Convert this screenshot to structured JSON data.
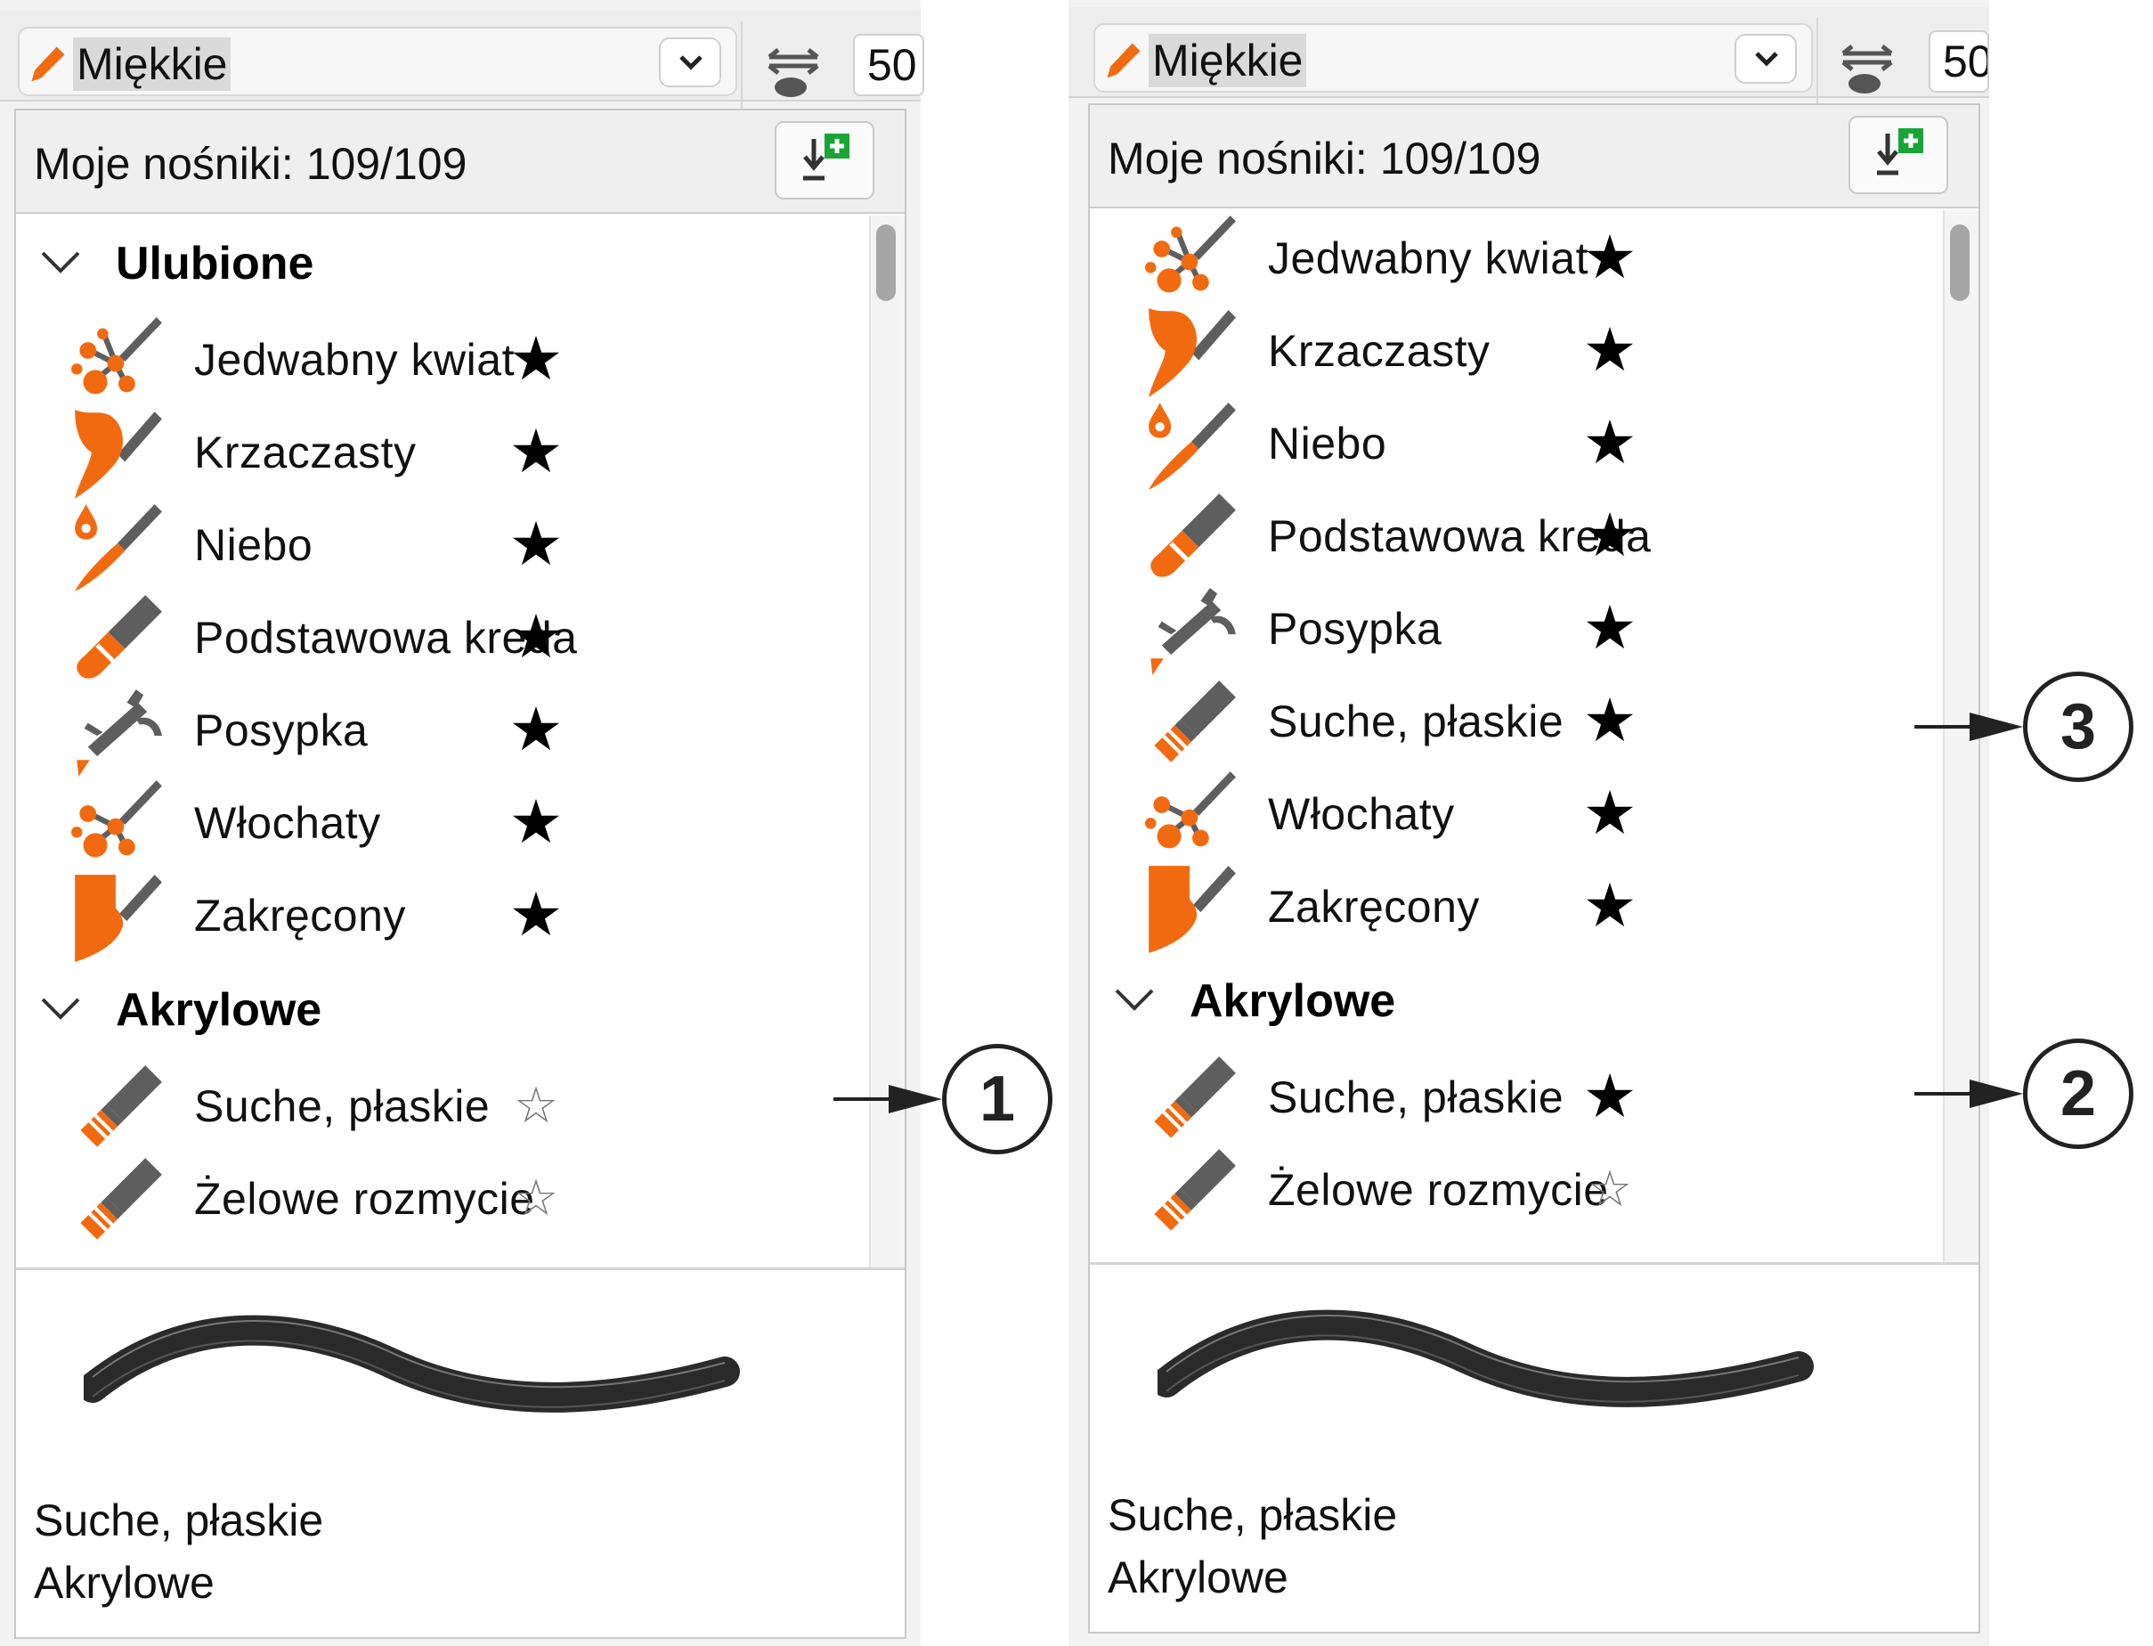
{
  "left_panel": {
    "preset_name": "Miękkie",
    "size_value": "50",
    "media_count": "Moje nośniki: 109/109",
    "categories": [
      {
        "label": "Ulubione",
        "items": [
          {
            "label": "Jedwabny kwiat",
            "icon": "silk-flower-brush-icon",
            "fav": true
          },
          {
            "label": "Krzaczasty",
            "icon": "bushy-brush-icon",
            "fav": true
          },
          {
            "label": "Niebo",
            "icon": "sky-brush-icon",
            "fav": true
          },
          {
            "label": "Podstawowa kreda",
            "icon": "basic-chalk-icon",
            "fav": true
          },
          {
            "label": "Posypka",
            "icon": "sprinkle-airbrush-icon",
            "fav": true
          },
          {
            "label": "Włochaty",
            "icon": "hairy-brush-icon",
            "fav": true
          },
          {
            "label": "Zakręcony",
            "icon": "curly-brush-icon",
            "fav": true
          }
        ]
      },
      {
        "label": "Akrylowe",
        "items": [
          {
            "label": "Suche, płaskie",
            "icon": "dry-flat-brush-icon",
            "fav": false
          },
          {
            "label": "Żelowe rozmycie",
            "icon": "gel-blend-brush-icon",
            "fav": false
          }
        ]
      }
    ],
    "preview": {
      "name": "Suche, płaskie",
      "category": "Akrylowe"
    },
    "callout": "1"
  },
  "right_panel": {
    "preset_name": "Miękkie",
    "size_value": "50",
    "media_count": "Moje nośniki: 109/109",
    "favorites": [
      {
        "label": "Jedwabny kwiat",
        "icon": "silk-flower-brush-icon",
        "fav": true
      },
      {
        "label": "Krzaczasty",
        "icon": "bushy-brush-icon",
        "fav": true
      },
      {
        "label": "Niebo",
        "icon": "sky-brush-icon",
        "fav": true
      },
      {
        "label": "Podstawowa kreda",
        "icon": "basic-chalk-icon",
        "fav": true
      },
      {
        "label": "Posypka",
        "icon": "sprinkle-airbrush-icon",
        "fav": true
      },
      {
        "label": "Suche, płaskie",
        "icon": "dry-flat-brush-icon",
        "fav": true
      },
      {
        "label": "Włochaty",
        "icon": "hairy-brush-icon",
        "fav": true
      },
      {
        "label": "Zakręcony",
        "icon": "curly-brush-icon",
        "fav": true
      }
    ],
    "category": {
      "label": "Akrylowe",
      "items": [
        {
          "label": "Suche, płaskie",
          "icon": "dry-flat-brush-icon",
          "fav": true
        },
        {
          "label": "Żelowe rozmycie",
          "icon": "gel-blend-brush-icon",
          "fav": false
        }
      ]
    },
    "preview": {
      "name": "Suche, płaskie",
      "category": "Akrylowe"
    },
    "callouts": [
      "3",
      "2"
    ]
  },
  "glyphs": {
    "star_filled": "★",
    "star_outline": "☆"
  },
  "colors": {
    "accent_orange": "#f26a10",
    "icon_gray": "#5e5e5e",
    "import_green": "#18a536"
  }
}
